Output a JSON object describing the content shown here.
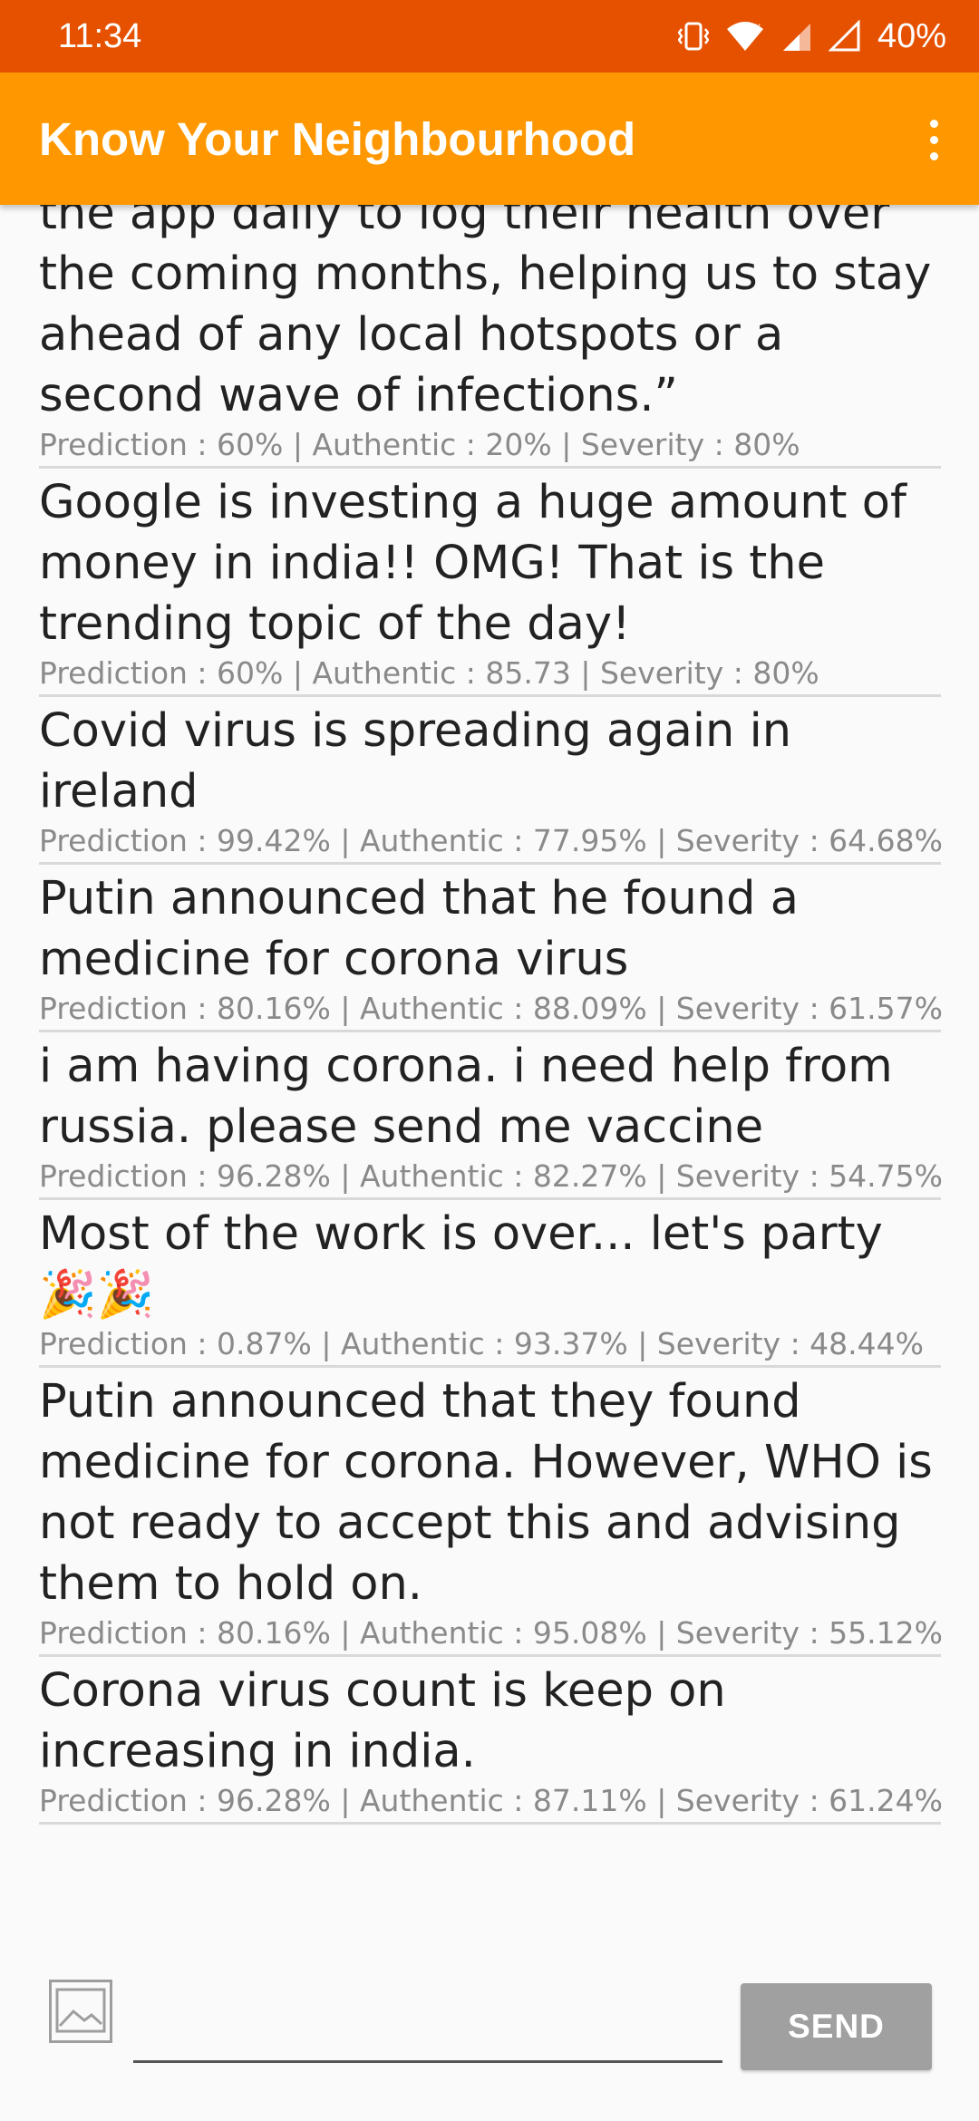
{
  "status_bar": {
    "time": "11:34",
    "battery_percent": "40%",
    "icons": [
      "vibrate-icon",
      "wifi-icon",
      "cell-signal-no-data-icon",
      "cell-signal-icon"
    ]
  },
  "app_bar": {
    "title": "Know Your Neighbourhood",
    "menu_icon": "more-vert-icon"
  },
  "colors": {
    "status_bar": "#e65100",
    "app_bar": "#ff9800",
    "send_button": "#a0a0a0"
  },
  "feed": {
    "posts": [
      {
        "text": "the app daily to log their health over the coming months, helping us to stay ahead of any local hotspots or a second wave of infections.”",
        "meta": "Prediction : 60% | Authentic : 20% | Severity : 80%"
      },
      {
        "text": "Google is investing a huge amount of money in india!! OMG! That is the trending topic of the day!",
        "meta": "Prediction : 60% | Authentic : 85.73 | Severity : 80%"
      },
      {
        "text": "Covid virus is spreading again in ireland",
        "meta": "Prediction : 99.42% | Authentic : 77.95% | Severity : 64.68%"
      },
      {
        "text": "Putin announced that he found a medicine for corona virus",
        "meta": "Prediction : 80.16% | Authentic : 88.09% | Severity : 61.57%"
      },
      {
        "text": "i am having corona. i need help from russia. please send me vaccine",
        "meta": "Prediction : 96.28% | Authentic : 82.27% | Severity : 54.75%"
      },
      {
        "text": "Most of the work is over... let's party 🎉🎉",
        "meta": "Prediction : 0.87% | Authentic : 93.37% | Severity : 48.44%"
      },
      {
        "text": "Putin announced that they found medicine for corona. However, WHO is not ready to accept this and advising them to hold on.",
        "meta": "Prediction : 80.16% | Authentic : 95.08% | Severity : 55.12%"
      },
      {
        "text": "Corona virus count is keep on increasing in india.",
        "meta": "Prediction : 96.28% | Authentic : 87.11% | Severity : 61.24%"
      }
    ]
  },
  "composer": {
    "image_icon": "image-icon",
    "input_value": "",
    "send_label": "SEND"
  }
}
